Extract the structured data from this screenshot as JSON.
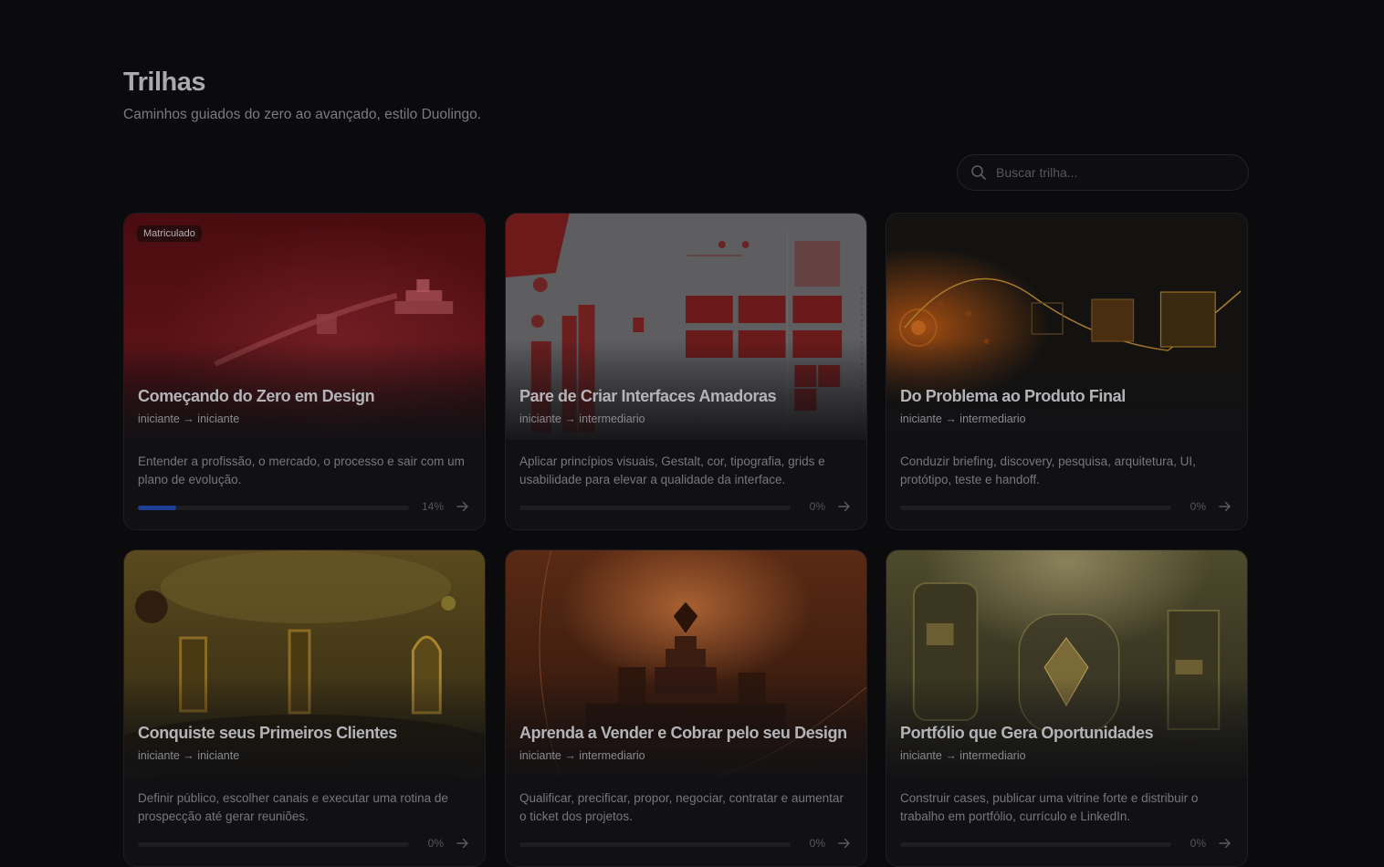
{
  "header": {
    "title": "Trilhas",
    "subtitle": "Caminhos guiados do zero ao avançado, estilo Duolingo."
  },
  "search": {
    "placeholder": "Buscar trilha...",
    "icon": "search-icon"
  },
  "colors": {
    "background": "#0b0b0d",
    "progress_fill": "#1f3f94"
  },
  "tracks": [
    {
      "badge": "Matriculado",
      "title": "Começando do Zero em Design",
      "levels": "iniciante → iniciante",
      "description": "Entender a profissão, o mercado, o processo e sair com um plano de evolução.",
      "progress_percent": 14,
      "progress_label": "14%",
      "theme": "red"
    },
    {
      "badge": "",
      "title": "Pare de Criar Interfaces Amadoras",
      "levels": "iniciante → intermediario",
      "description": "Aplicar princípios visuais, Gestalt, cor, tipografia, grids e usabilidade para elevar a qualidade da interface.",
      "progress_percent": 0,
      "progress_label": "0%",
      "theme": "white-red"
    },
    {
      "badge": "",
      "title": "Do Problema ao Produto Final",
      "levels": "iniciante → intermediario",
      "description": "Conduzir briefing, discovery, pesquisa, arquitetura, UI, protótipo, teste e handoff.",
      "progress_percent": 0,
      "progress_label": "0%",
      "theme": "dark-gold"
    },
    {
      "badge": "",
      "title": "Conquiste seus Primeiros Clientes",
      "levels": "iniciante → iniciante",
      "description": "Definir público, escolher canais e executar uma rotina de prospecção até gerar reuniões.",
      "progress_percent": 0,
      "progress_label": "0%",
      "theme": "gold"
    },
    {
      "badge": "",
      "title": "Aprenda a Vender e Cobrar pelo seu Design",
      "levels": "iniciante → intermediario",
      "description": "Qualificar, precificar, propor, negociar, contratar e aumentar o ticket dos projetos.",
      "progress_percent": 0,
      "progress_label": "0%",
      "theme": "orange"
    },
    {
      "badge": "",
      "title": "Portfólio que Gera Oportunidades",
      "levels": "iniciante → intermediario",
      "description": "Construir cases, publicar uma vitrine forte e distribuir o trabalho em portfólio, currículo e LinkedIn.",
      "progress_percent": 0,
      "progress_label": "0%",
      "theme": "olive"
    }
  ]
}
